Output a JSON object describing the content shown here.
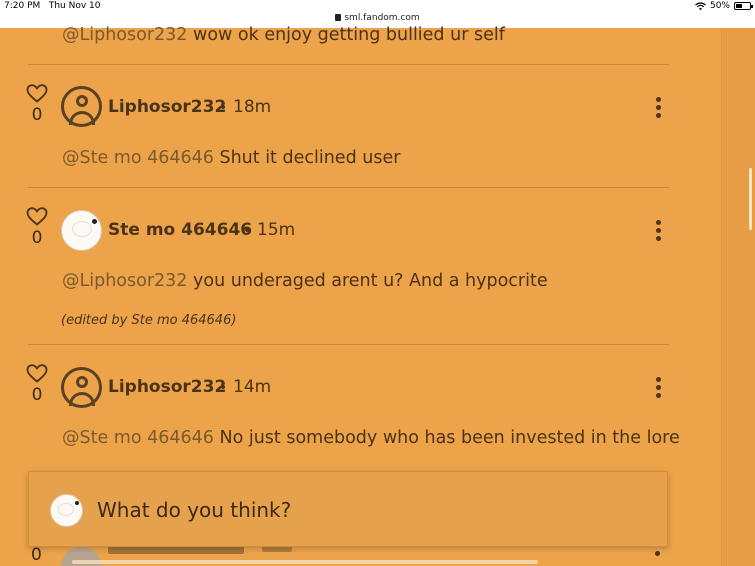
{
  "status_bar": {
    "time": "7:20 PM",
    "date": "Thu Nov 10",
    "battery": "50%",
    "wifi_icon": "wifi-icon",
    "battery_icon": "battery-icon"
  },
  "browser": {
    "url": "sml.fandom.com",
    "lock_icon": "lock-icon"
  },
  "colors": {
    "background": "#eca34a",
    "text": "#4a3318",
    "mention": "#7a5a2c"
  },
  "comments": [
    {
      "mention": "@Liphosor232",
      "text": " wow ok enjoy getting bullied ur self"
    },
    {
      "likes": "0",
      "author": "Liphosor232",
      "time": "18m",
      "mention": "@Ste mo 464646",
      "text": " Shut it declined user",
      "avatar": "default-avatar"
    },
    {
      "likes": "0",
      "author": "Ste mo 464646",
      "time": "15m",
      "mention": "@Liphosor232",
      "text": " you underaged arent u? And a hypocrite",
      "edited": "(edited by Ste mo 464646)",
      "avatar": "image-avatar"
    },
    {
      "likes": "0",
      "author": "Liphosor232",
      "time": "14m",
      "mention": "@Ste mo 464646",
      "text": " No just somebody who has been invested in the lore",
      "avatar": "default-avatar"
    }
  ],
  "peek_comment": {
    "likes": "0"
  },
  "composer": {
    "placeholder": "What do you think?"
  },
  "separator": "•"
}
